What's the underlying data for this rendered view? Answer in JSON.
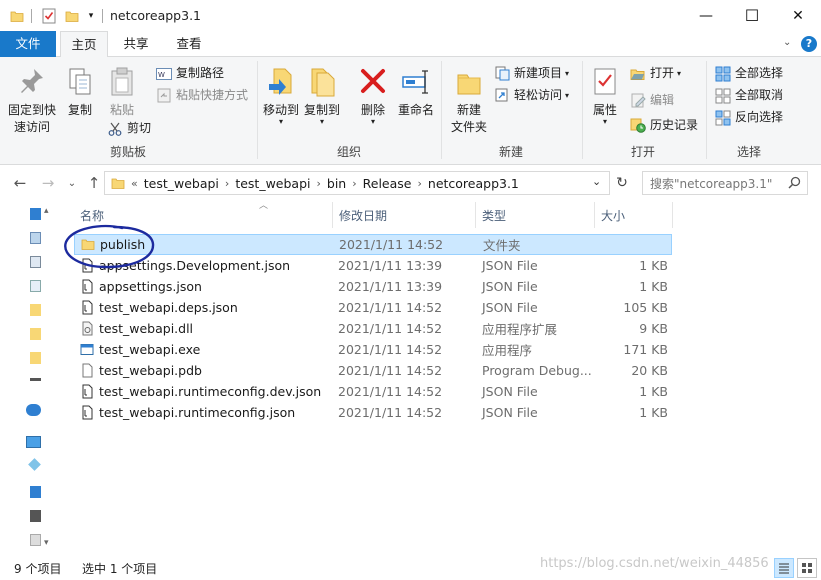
{
  "window": {
    "title": "netcoreapp3.1",
    "minimize": "—",
    "maximize": "☐",
    "close": "✕"
  },
  "ribbon_tabs": {
    "file": "文件",
    "home": "主页",
    "share": "共享",
    "view": "查看",
    "help": "?"
  },
  "ribbon": {
    "clipboard": {
      "pin": "固定到快\n速访问",
      "copy": "复制",
      "paste": "粘贴",
      "copy_path": "复制路径",
      "paste_shortcut": "粘贴快捷方式",
      "cut": "剪切",
      "group": "剪贴板"
    },
    "organize": {
      "move_to": "移动到",
      "copy_to": "复制到",
      "delete": "删除",
      "rename": "重命名",
      "group": "组织"
    },
    "new": {
      "new_folder": "新建\n文件夹",
      "new_item": "新建项目",
      "easy_access": "轻松访问",
      "group": "新建"
    },
    "open": {
      "properties": "属性",
      "open": "打开",
      "edit": "编辑",
      "history": "历史记录",
      "group": "打开"
    },
    "select": {
      "select_all": "全部选择",
      "select_none": "全部取消",
      "invert": "反向选择",
      "group": "选择"
    }
  },
  "address": {
    "overflow": "«",
    "crumbs": [
      "test_webapi",
      "test_webapi",
      "bin",
      "Release",
      "netcoreapp3.1"
    ],
    "search_placeholder": "搜索\"netcoreapp3.1\""
  },
  "columns": {
    "name": "名称",
    "date": "修改日期",
    "type": "类型",
    "size": "大小"
  },
  "files": [
    {
      "name": "publish",
      "date": "2021/1/11 14:52",
      "type": "文件夹",
      "size": "",
      "icon": "folder-icon",
      "selected": true
    },
    {
      "name": "appsettings.Development.json",
      "date": "2021/1/11 13:39",
      "type": "JSON File",
      "size": "1 KB",
      "icon": "json-file-icon"
    },
    {
      "name": "appsettings.json",
      "date": "2021/1/11 13:39",
      "type": "JSON File",
      "size": "1 KB",
      "icon": "json-file-icon"
    },
    {
      "name": "test_webapi.deps.json",
      "date": "2021/1/11 14:52",
      "type": "JSON File",
      "size": "105 KB",
      "icon": "json-file-icon"
    },
    {
      "name": "test_webapi.dll",
      "date": "2021/1/11 14:52",
      "type": "应用程序扩展",
      "size": "9 KB",
      "icon": "dll-file-icon"
    },
    {
      "name": "test_webapi.exe",
      "date": "2021/1/11 14:52",
      "type": "应用程序",
      "size": "171 KB",
      "icon": "exe-file-icon"
    },
    {
      "name": "test_webapi.pdb",
      "date": "2021/1/11 14:52",
      "type": "Program Debug...",
      "size": "20 KB",
      "icon": "pdb-file-icon"
    },
    {
      "name": "test_webapi.runtimeconfig.dev.json",
      "date": "2021/1/11 14:52",
      "type": "JSON File",
      "size": "1 KB",
      "icon": "json-file-icon"
    },
    {
      "name": "test_webapi.runtimeconfig.json",
      "date": "2021/1/11 14:52",
      "type": "JSON File",
      "size": "1 KB",
      "icon": "json-file-icon"
    }
  ],
  "status": {
    "count": "9 个项目",
    "selected": "选中 1 个项目",
    "watermark": "https://blog.csdn.net/weixin_44856"
  },
  "colors": {
    "accent": "#1979ca",
    "selection": "#cce8ff",
    "folder": "#f8d775",
    "annotation": "#1c2a9e"
  }
}
